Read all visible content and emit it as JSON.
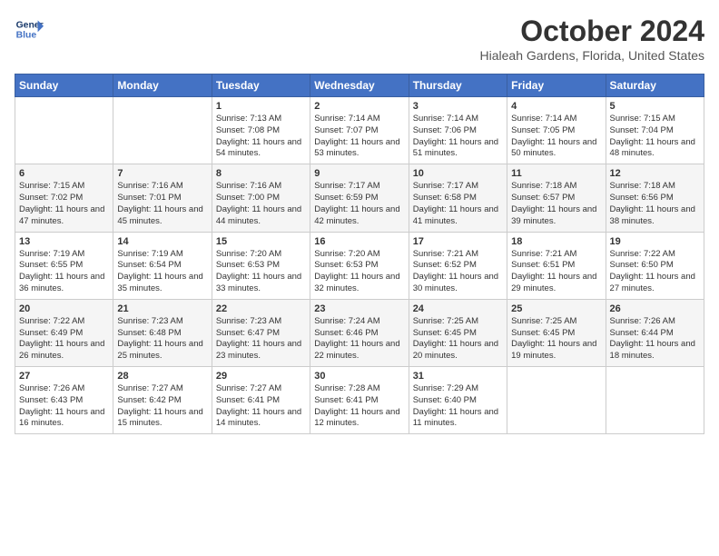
{
  "header": {
    "logo_line1": "General",
    "logo_line2": "Blue",
    "month_title": "October 2024",
    "location": "Hialeah Gardens, Florida, United States"
  },
  "weekdays": [
    "Sunday",
    "Monday",
    "Tuesday",
    "Wednesday",
    "Thursday",
    "Friday",
    "Saturday"
  ],
  "weeks": [
    [
      {
        "day": "",
        "info": ""
      },
      {
        "day": "",
        "info": ""
      },
      {
        "day": "1",
        "info": "Sunrise: 7:13 AM\nSunset: 7:08 PM\nDaylight: 11 hours and 54 minutes."
      },
      {
        "day": "2",
        "info": "Sunrise: 7:14 AM\nSunset: 7:07 PM\nDaylight: 11 hours and 53 minutes."
      },
      {
        "day": "3",
        "info": "Sunrise: 7:14 AM\nSunset: 7:06 PM\nDaylight: 11 hours and 51 minutes."
      },
      {
        "day": "4",
        "info": "Sunrise: 7:14 AM\nSunset: 7:05 PM\nDaylight: 11 hours and 50 minutes."
      },
      {
        "day": "5",
        "info": "Sunrise: 7:15 AM\nSunset: 7:04 PM\nDaylight: 11 hours and 48 minutes."
      }
    ],
    [
      {
        "day": "6",
        "info": "Sunrise: 7:15 AM\nSunset: 7:02 PM\nDaylight: 11 hours and 47 minutes."
      },
      {
        "day": "7",
        "info": "Sunrise: 7:16 AM\nSunset: 7:01 PM\nDaylight: 11 hours and 45 minutes."
      },
      {
        "day": "8",
        "info": "Sunrise: 7:16 AM\nSunset: 7:00 PM\nDaylight: 11 hours and 44 minutes."
      },
      {
        "day": "9",
        "info": "Sunrise: 7:17 AM\nSunset: 6:59 PM\nDaylight: 11 hours and 42 minutes."
      },
      {
        "day": "10",
        "info": "Sunrise: 7:17 AM\nSunset: 6:58 PM\nDaylight: 11 hours and 41 minutes."
      },
      {
        "day": "11",
        "info": "Sunrise: 7:18 AM\nSunset: 6:57 PM\nDaylight: 11 hours and 39 minutes."
      },
      {
        "day": "12",
        "info": "Sunrise: 7:18 AM\nSunset: 6:56 PM\nDaylight: 11 hours and 38 minutes."
      }
    ],
    [
      {
        "day": "13",
        "info": "Sunrise: 7:19 AM\nSunset: 6:55 PM\nDaylight: 11 hours and 36 minutes."
      },
      {
        "day": "14",
        "info": "Sunrise: 7:19 AM\nSunset: 6:54 PM\nDaylight: 11 hours and 35 minutes."
      },
      {
        "day": "15",
        "info": "Sunrise: 7:20 AM\nSunset: 6:53 PM\nDaylight: 11 hours and 33 minutes."
      },
      {
        "day": "16",
        "info": "Sunrise: 7:20 AM\nSunset: 6:53 PM\nDaylight: 11 hours and 32 minutes."
      },
      {
        "day": "17",
        "info": "Sunrise: 7:21 AM\nSunset: 6:52 PM\nDaylight: 11 hours and 30 minutes."
      },
      {
        "day": "18",
        "info": "Sunrise: 7:21 AM\nSunset: 6:51 PM\nDaylight: 11 hours and 29 minutes."
      },
      {
        "day": "19",
        "info": "Sunrise: 7:22 AM\nSunset: 6:50 PM\nDaylight: 11 hours and 27 minutes."
      }
    ],
    [
      {
        "day": "20",
        "info": "Sunrise: 7:22 AM\nSunset: 6:49 PM\nDaylight: 11 hours and 26 minutes."
      },
      {
        "day": "21",
        "info": "Sunrise: 7:23 AM\nSunset: 6:48 PM\nDaylight: 11 hours and 25 minutes."
      },
      {
        "day": "22",
        "info": "Sunrise: 7:23 AM\nSunset: 6:47 PM\nDaylight: 11 hours and 23 minutes."
      },
      {
        "day": "23",
        "info": "Sunrise: 7:24 AM\nSunset: 6:46 PM\nDaylight: 11 hours and 22 minutes."
      },
      {
        "day": "24",
        "info": "Sunrise: 7:25 AM\nSunset: 6:45 PM\nDaylight: 11 hours and 20 minutes."
      },
      {
        "day": "25",
        "info": "Sunrise: 7:25 AM\nSunset: 6:45 PM\nDaylight: 11 hours and 19 minutes."
      },
      {
        "day": "26",
        "info": "Sunrise: 7:26 AM\nSunset: 6:44 PM\nDaylight: 11 hours and 18 minutes."
      }
    ],
    [
      {
        "day": "27",
        "info": "Sunrise: 7:26 AM\nSunset: 6:43 PM\nDaylight: 11 hours and 16 minutes."
      },
      {
        "day": "28",
        "info": "Sunrise: 7:27 AM\nSunset: 6:42 PM\nDaylight: 11 hours and 15 minutes."
      },
      {
        "day": "29",
        "info": "Sunrise: 7:27 AM\nSunset: 6:41 PM\nDaylight: 11 hours and 14 minutes."
      },
      {
        "day": "30",
        "info": "Sunrise: 7:28 AM\nSunset: 6:41 PM\nDaylight: 11 hours and 12 minutes."
      },
      {
        "day": "31",
        "info": "Sunrise: 7:29 AM\nSunset: 6:40 PM\nDaylight: 11 hours and 11 minutes."
      },
      {
        "day": "",
        "info": ""
      },
      {
        "day": "",
        "info": ""
      }
    ]
  ]
}
